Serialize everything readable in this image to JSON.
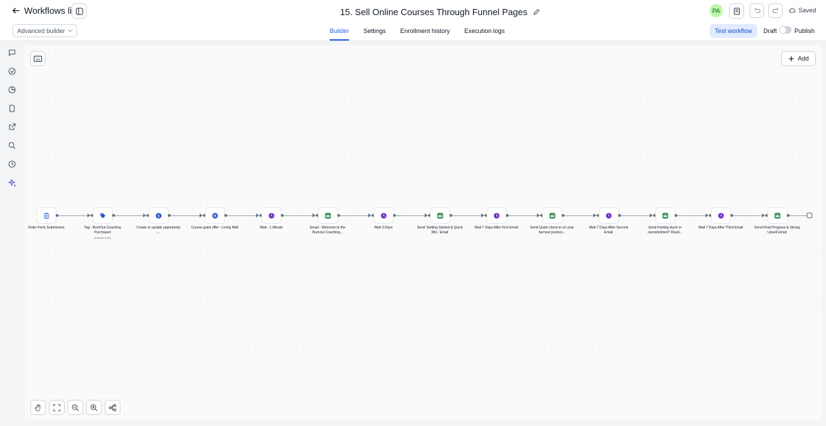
{
  "header": {
    "back_label": "Workflows list",
    "title": "15. Sell Online Courses Through Funnel Pages",
    "avatar_initials": "PA",
    "saved_label": "Saved"
  },
  "subbar": {
    "builder_mode": "Advanced builder",
    "tabs": [
      {
        "label": "Builder",
        "active": true
      },
      {
        "label": "Settings",
        "active": false
      },
      {
        "label": "Enrollment history",
        "active": false
      },
      {
        "label": "Execution logs",
        "active": false
      }
    ],
    "test_label": "Test workflow",
    "draft_label": "Draft",
    "publish_label": "Publish"
  },
  "canvas": {
    "add_label": "Add"
  },
  "workflow": {
    "steps": [
      {
        "label": "Order Form Submission",
        "icon": "clipboard-icon",
        "color": "#2563eb"
      },
      {
        "label": "Tag - BurnOut Coaching Purchased",
        "sublabel": "(Default Path)",
        "icon": "tag-icon",
        "color": "#1d4ed8"
      },
      {
        "label": "Create or update opportunity -...",
        "icon": "dollar-icon",
        "color": "#1d4ed8"
      },
      {
        "label": "Course grant offer - Living Well",
        "icon": "course-icon",
        "color": "#1d4ed8"
      },
      {
        "label": "Wait - 1 Minute",
        "icon": "clock-icon",
        "color": "#6d28d9"
      },
      {
        "label": "Email - Welcome to the Burnout Coaching...",
        "icon": "email-icon",
        "color": "#15803d"
      },
      {
        "label": "Wait 3 Days",
        "icon": "clock-icon",
        "color": "#6d28d9"
      },
      {
        "label": "Send 'Getting Started & Quick Win,' Email",
        "icon": "email-icon",
        "color": "#15803d"
      },
      {
        "label": "Wait 7 Days After First Email",
        "icon": "clock-icon",
        "color": "#6d28d9"
      },
      {
        "label": "Send Quick check-in on your burnout journey...",
        "icon": "email-icon",
        "color": "#15803d"
      },
      {
        "label": "Wait 7 Days After Second Email",
        "icon": "clock-icon",
        "color": "#6d28d9"
      },
      {
        "label": "Send Feeling stuck or overwhelmed? Read...",
        "icon": "email-icon",
        "color": "#15803d"
      },
      {
        "label": "Wait 7 Days After Third Email",
        "icon": "clock-icon",
        "color": "#6d28d9"
      },
      {
        "label": "Send Final Progress & Strong Upsell Email",
        "icon": "email-icon",
        "color": "#15803d"
      }
    ]
  }
}
